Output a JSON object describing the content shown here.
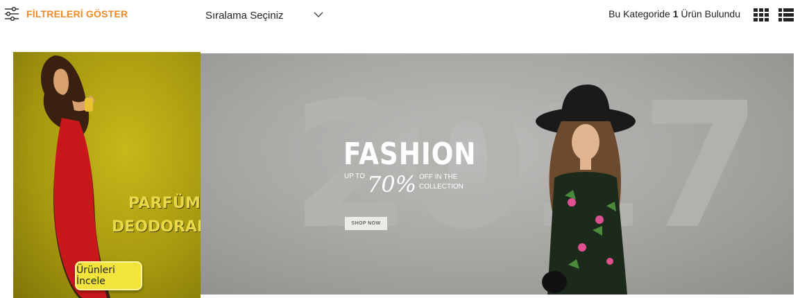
{
  "toolbar": {
    "filter_label": "FİLTRELERİ GÖSTER",
    "sort_label": "Sıralama Seçiniz",
    "result_prefix": "Bu Kategoride",
    "result_count": "1",
    "result_suffix": "Ürün Bulundu",
    "icons": [
      "filter-sliders-icon",
      "chevron-down-icon",
      "grid-view-icon",
      "list-view-icon"
    ]
  },
  "banner_left": {
    "line1": "PARFÜM &",
    "line2": "DEODORANT",
    "button_label": "Ürünleri İncele"
  },
  "banner_main": {
    "year": "2017",
    "headline": "FASHION",
    "up_to": "UP TO",
    "percent": "70%",
    "off_in": "OFF IN THE",
    "collection": "COLLECTION",
    "cta": "SHOP NOW"
  },
  "colors": {
    "accent": "#f08a24",
    "banner_left_bg": "#b3a513",
    "banner_main_bg": "#a9a7a4"
  }
}
